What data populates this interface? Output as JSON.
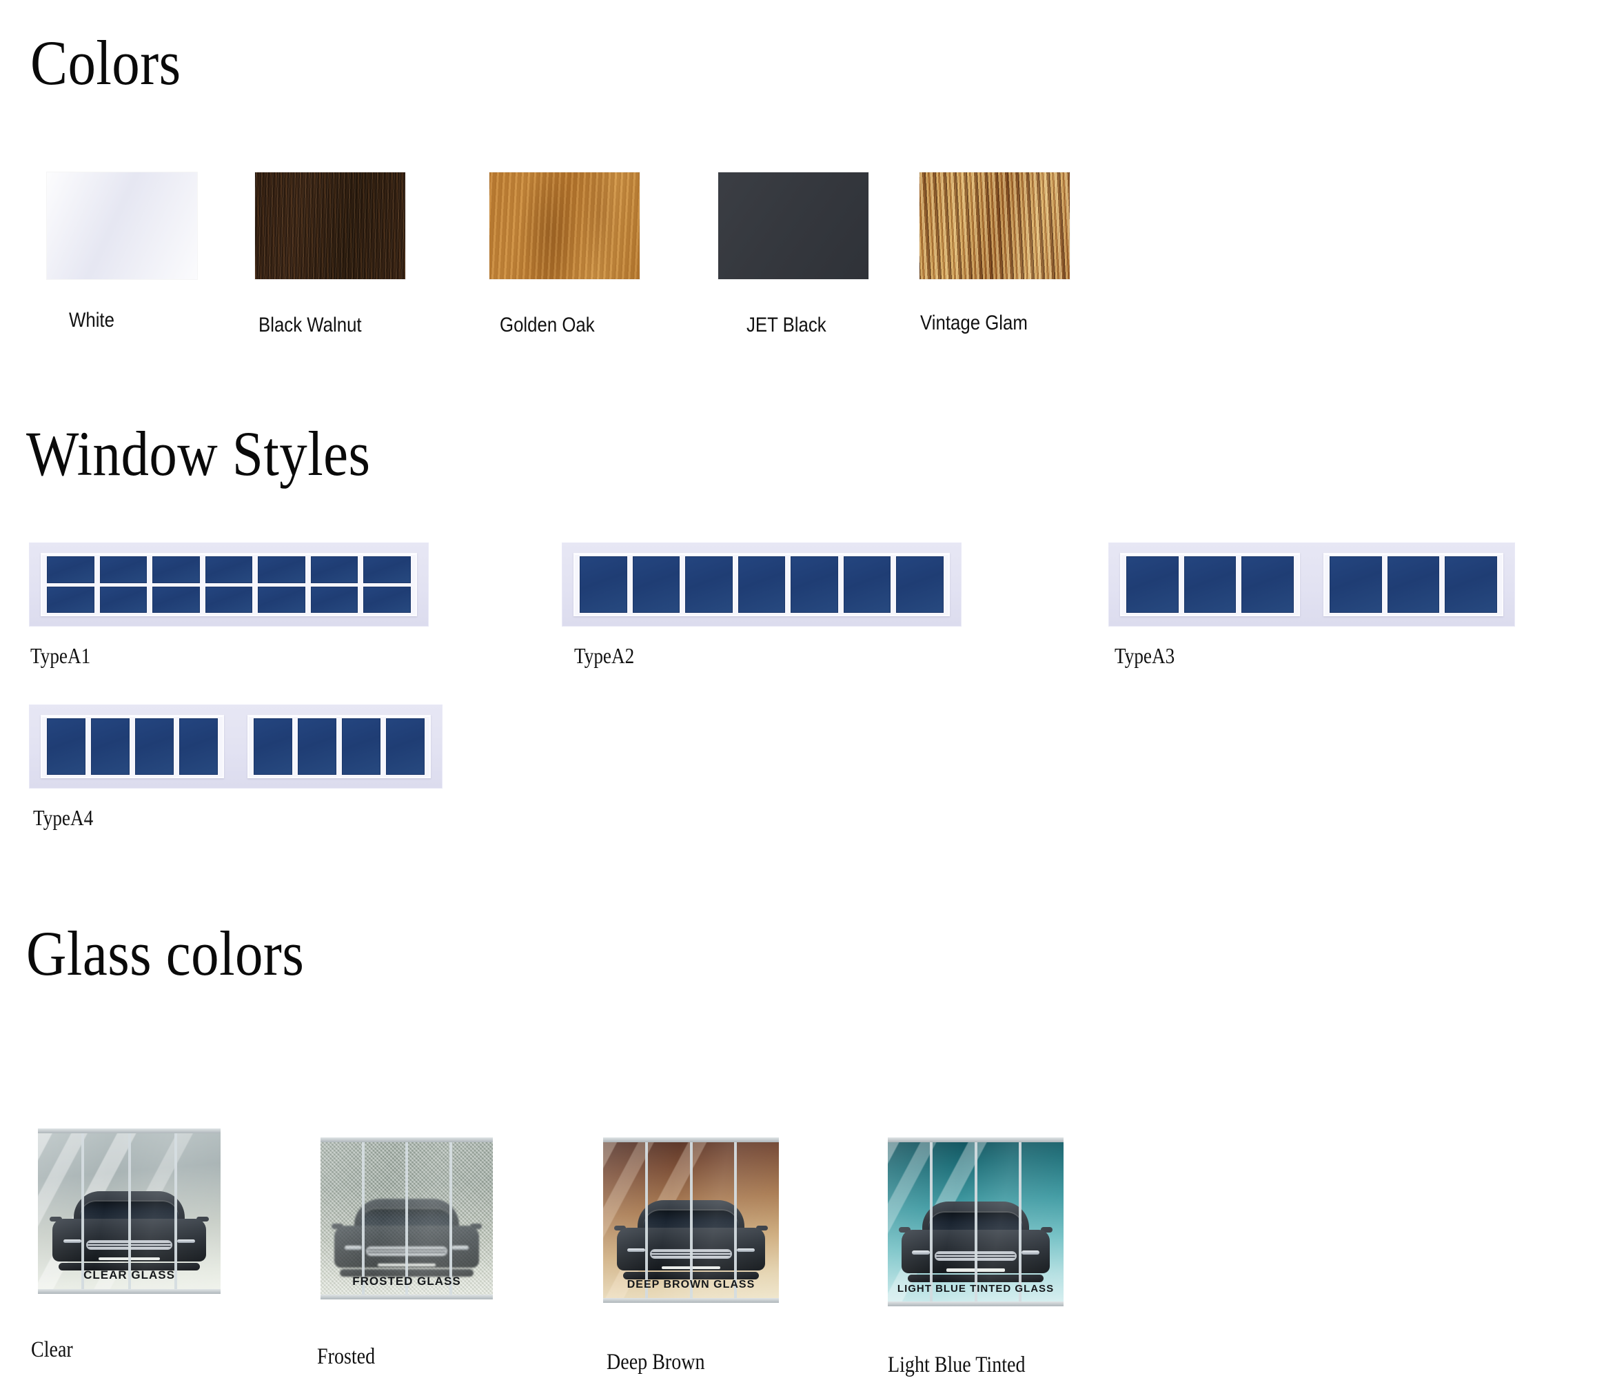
{
  "sections": {
    "colors": {
      "heading": "Colors"
    },
    "window_styles": {
      "heading": "Window Styles"
    },
    "glass_colors": {
      "heading": "Glass colors"
    }
  },
  "colors": {
    "swatches": [
      {
        "label": "White",
        "swatch_name": "white-swatch",
        "hex": "#e4e5f1"
      },
      {
        "label": "Black Walnut",
        "swatch_name": "black-walnut-swatch",
        "hex": "#3b2413"
      },
      {
        "label": "Golden Oak",
        "swatch_name": "golden-oak-swatch",
        "hex": "#c07f33"
      },
      {
        "label": "JET Black",
        "swatch_name": "jet-black-swatch",
        "hex": "#35383e"
      },
      {
        "label": "Vintage Glam",
        "swatch_name": "vintage-glam-swatch",
        "hex": "#b1762f"
      }
    ]
  },
  "window_styles": {
    "pane_color": "#1f3d74",
    "frame_color": "#e3e3f3",
    "items": [
      {
        "label": "TypeA1",
        "groups": [
          7
        ],
        "rows": 2
      },
      {
        "label": "TypeA2",
        "groups": [
          7
        ],
        "rows": 1
      },
      {
        "label": "TypeA3",
        "groups": [
          3,
          3
        ],
        "rows": 1
      },
      {
        "label": "TypeA4",
        "groups": [
          4,
          4
        ],
        "rows": 1
      }
    ]
  },
  "glass_colors": {
    "panels_per_tile": 4,
    "items": [
      {
        "label": "Clear",
        "caption": "CLEAR GLASS",
        "tint": "#b9c3c4"
      },
      {
        "label": "Frosted",
        "caption": "FROSTED GLASS",
        "tint": "#9aa79e"
      },
      {
        "label": "Deep Brown",
        "caption": "DEEP BROWN GLASS",
        "tint": "#a97b52"
      },
      {
        "label": "Light Blue Tinted",
        "caption": "LIGHT BLUE TINTED GLASS",
        "tint": "#3f9aa2"
      }
    ]
  }
}
